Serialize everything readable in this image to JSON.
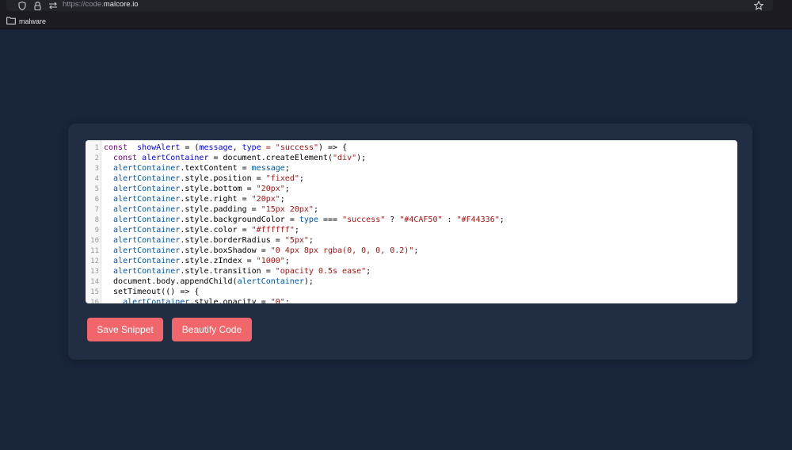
{
  "browser": {
    "url_prefix": "https://code.",
    "url_domain": "malcore.io",
    "toolbar_icons": [
      "shield-icon",
      "lock-icon",
      "connection-icon",
      "star-icon"
    ]
  },
  "bookmarks": {
    "items": [
      {
        "label": "malware",
        "icon": "folder-icon"
      }
    ]
  },
  "editor": {
    "lines": [
      [
        [
          "k",
          "const"
        ],
        [
          "",
          "  "
        ],
        [
          "d",
          "showAlert"
        ],
        [
          "",
          " = ("
        ],
        [
          "d",
          "message"
        ],
        [
          "",
          ", "
        ],
        [
          "d",
          "type"
        ],
        [
          "o",
          " = "
        ],
        [
          "s",
          "\"success\""
        ],
        [
          "",
          ") => {"
        ]
      ],
      [
        [
          "",
          "  "
        ],
        [
          "k",
          "const"
        ],
        [
          "",
          ""
        ],
        [
          "d",
          " alertContainer"
        ],
        [
          "",
          " = document.createElement("
        ],
        [
          "s",
          "\"div\""
        ],
        [
          "",
          ");"
        ]
      ],
      [
        [
          "",
          "  "
        ],
        [
          "v",
          "alertContainer"
        ],
        [
          "",
          ".textContent = "
        ],
        [
          "v",
          "message"
        ],
        [
          "",
          ";"
        ]
      ],
      [
        [
          "",
          "  "
        ],
        [
          "v",
          "alertContainer"
        ],
        [
          "",
          ".style.position = "
        ],
        [
          "s",
          "\"fixed\""
        ],
        [
          "",
          ";"
        ]
      ],
      [
        [
          "",
          "  "
        ],
        [
          "v",
          "alertContainer"
        ],
        [
          "",
          ".style.bottom = "
        ],
        [
          "s",
          "\"20px\""
        ],
        [
          "",
          ";"
        ]
      ],
      [
        [
          "",
          "  "
        ],
        [
          "v",
          "alertContainer"
        ],
        [
          "",
          ".style.right = "
        ],
        [
          "s",
          "\"20px\""
        ],
        [
          "",
          ";"
        ]
      ],
      [
        [
          "",
          "  "
        ],
        [
          "v",
          "alertContainer"
        ],
        [
          "",
          ".style.padding = "
        ],
        [
          "s",
          "\"15px 20px\""
        ],
        [
          "",
          ";"
        ]
      ],
      [
        [
          "",
          "  "
        ],
        [
          "v",
          "alertContainer"
        ],
        [
          "",
          ".style.backgroundColor = "
        ],
        [
          "v",
          "type"
        ],
        [
          "",
          " === "
        ],
        [
          "s",
          "\"success\""
        ],
        [
          "",
          " ? "
        ],
        [
          "s",
          "\"#4CAF50\""
        ],
        [
          "",
          " : "
        ],
        [
          "s",
          "\"#F44336\""
        ],
        [
          "",
          ";"
        ]
      ],
      [
        [
          "",
          "  "
        ],
        [
          "v",
          "alertContainer"
        ],
        [
          "",
          ".style.color = "
        ],
        [
          "s",
          "\"#ffffff\""
        ],
        [
          "",
          ";"
        ]
      ],
      [
        [
          "",
          "  "
        ],
        [
          "v",
          "alertContainer"
        ],
        [
          "",
          ".style.borderRadius = "
        ],
        [
          "s",
          "\"5px\""
        ],
        [
          "",
          ";"
        ]
      ],
      [
        [
          "",
          "  "
        ],
        [
          "v",
          "alertContainer"
        ],
        [
          "",
          ".style.boxShadow = "
        ],
        [
          "s",
          "\"0 4px 8px rgba(0, 0, 0, 0.2)\""
        ],
        [
          "",
          ";"
        ]
      ],
      [
        [
          "",
          "  "
        ],
        [
          "v",
          "alertContainer"
        ],
        [
          "",
          ".style.zIndex = "
        ],
        [
          "s",
          "\"1000\""
        ],
        [
          "",
          ";"
        ]
      ],
      [
        [
          "",
          "  "
        ],
        [
          "v",
          "alertContainer"
        ],
        [
          "",
          ".style.transition = "
        ],
        [
          "s",
          "\"opacity 0.5s ease\""
        ],
        [
          "",
          ";"
        ]
      ],
      [
        [
          "",
          "  document.body.appendChild("
        ],
        [
          "v",
          "alertContainer"
        ],
        [
          "",
          ");"
        ]
      ],
      [
        [
          "",
          "  setTimeout(() => {"
        ]
      ],
      [
        [
          "",
          "    "
        ],
        [
          "v",
          "alertContainer"
        ],
        [
          "",
          ".style.opacity = "
        ],
        [
          "s",
          "\"0\""
        ],
        [
          "",
          ";"
        ]
      ]
    ]
  },
  "actions": {
    "save_label": "Save Snippet",
    "beautify_label": "Beautify Code"
  },
  "colors": {
    "page_background": "#18243a",
    "card_background": "#212d43",
    "button_accent": "#f0666a"
  }
}
